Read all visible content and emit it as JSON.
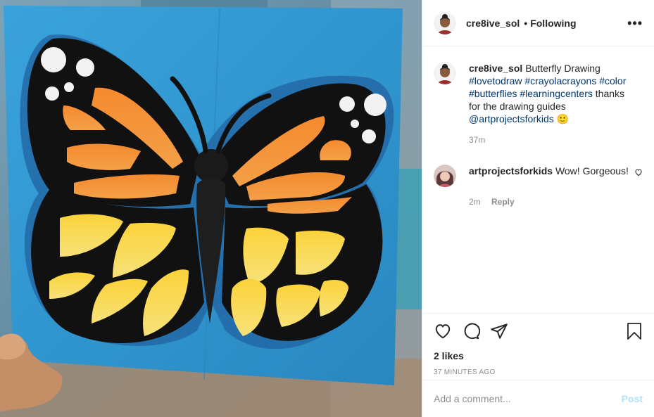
{
  "header": {
    "username": "cre8ive_sol",
    "separator": "•",
    "follow_status": "Following",
    "more_icon": "ellipsis-icon"
  },
  "caption": {
    "username": "cre8ive_sol",
    "text_before": "Butterfly Drawing",
    "hashtags": [
      "#lovetodraw",
      "#crayolacrayons",
      "#color",
      "#butterflies",
      "#learningcenters"
    ],
    "text_after": "thanks for the drawing guides",
    "mention": "@artprojectsforkids",
    "emoji": "🙂",
    "age": "37m"
  },
  "reply": {
    "username": "artprojectsforkids",
    "text": "Wow! Gorgeous!",
    "age": "2m",
    "reply_label": "Reply"
  },
  "actions": {
    "like_icon": "heart-icon",
    "comment_icon": "comment-icon",
    "share_icon": "paper-plane-icon",
    "save_icon": "bookmark-icon",
    "likes": "2 likes",
    "timestamp": "37 MINUTES AGO"
  },
  "add_comment": {
    "placeholder": "Add a comment...",
    "post_label": "Post"
  },
  "colors": {
    "link": "#00376b",
    "muted": "#8e8e8e",
    "post_disabled": "#b2dffc",
    "wing_orange": "#f2862a",
    "wing_yellow": "#f9d84a",
    "paper_blue": "#3b9fd6"
  }
}
